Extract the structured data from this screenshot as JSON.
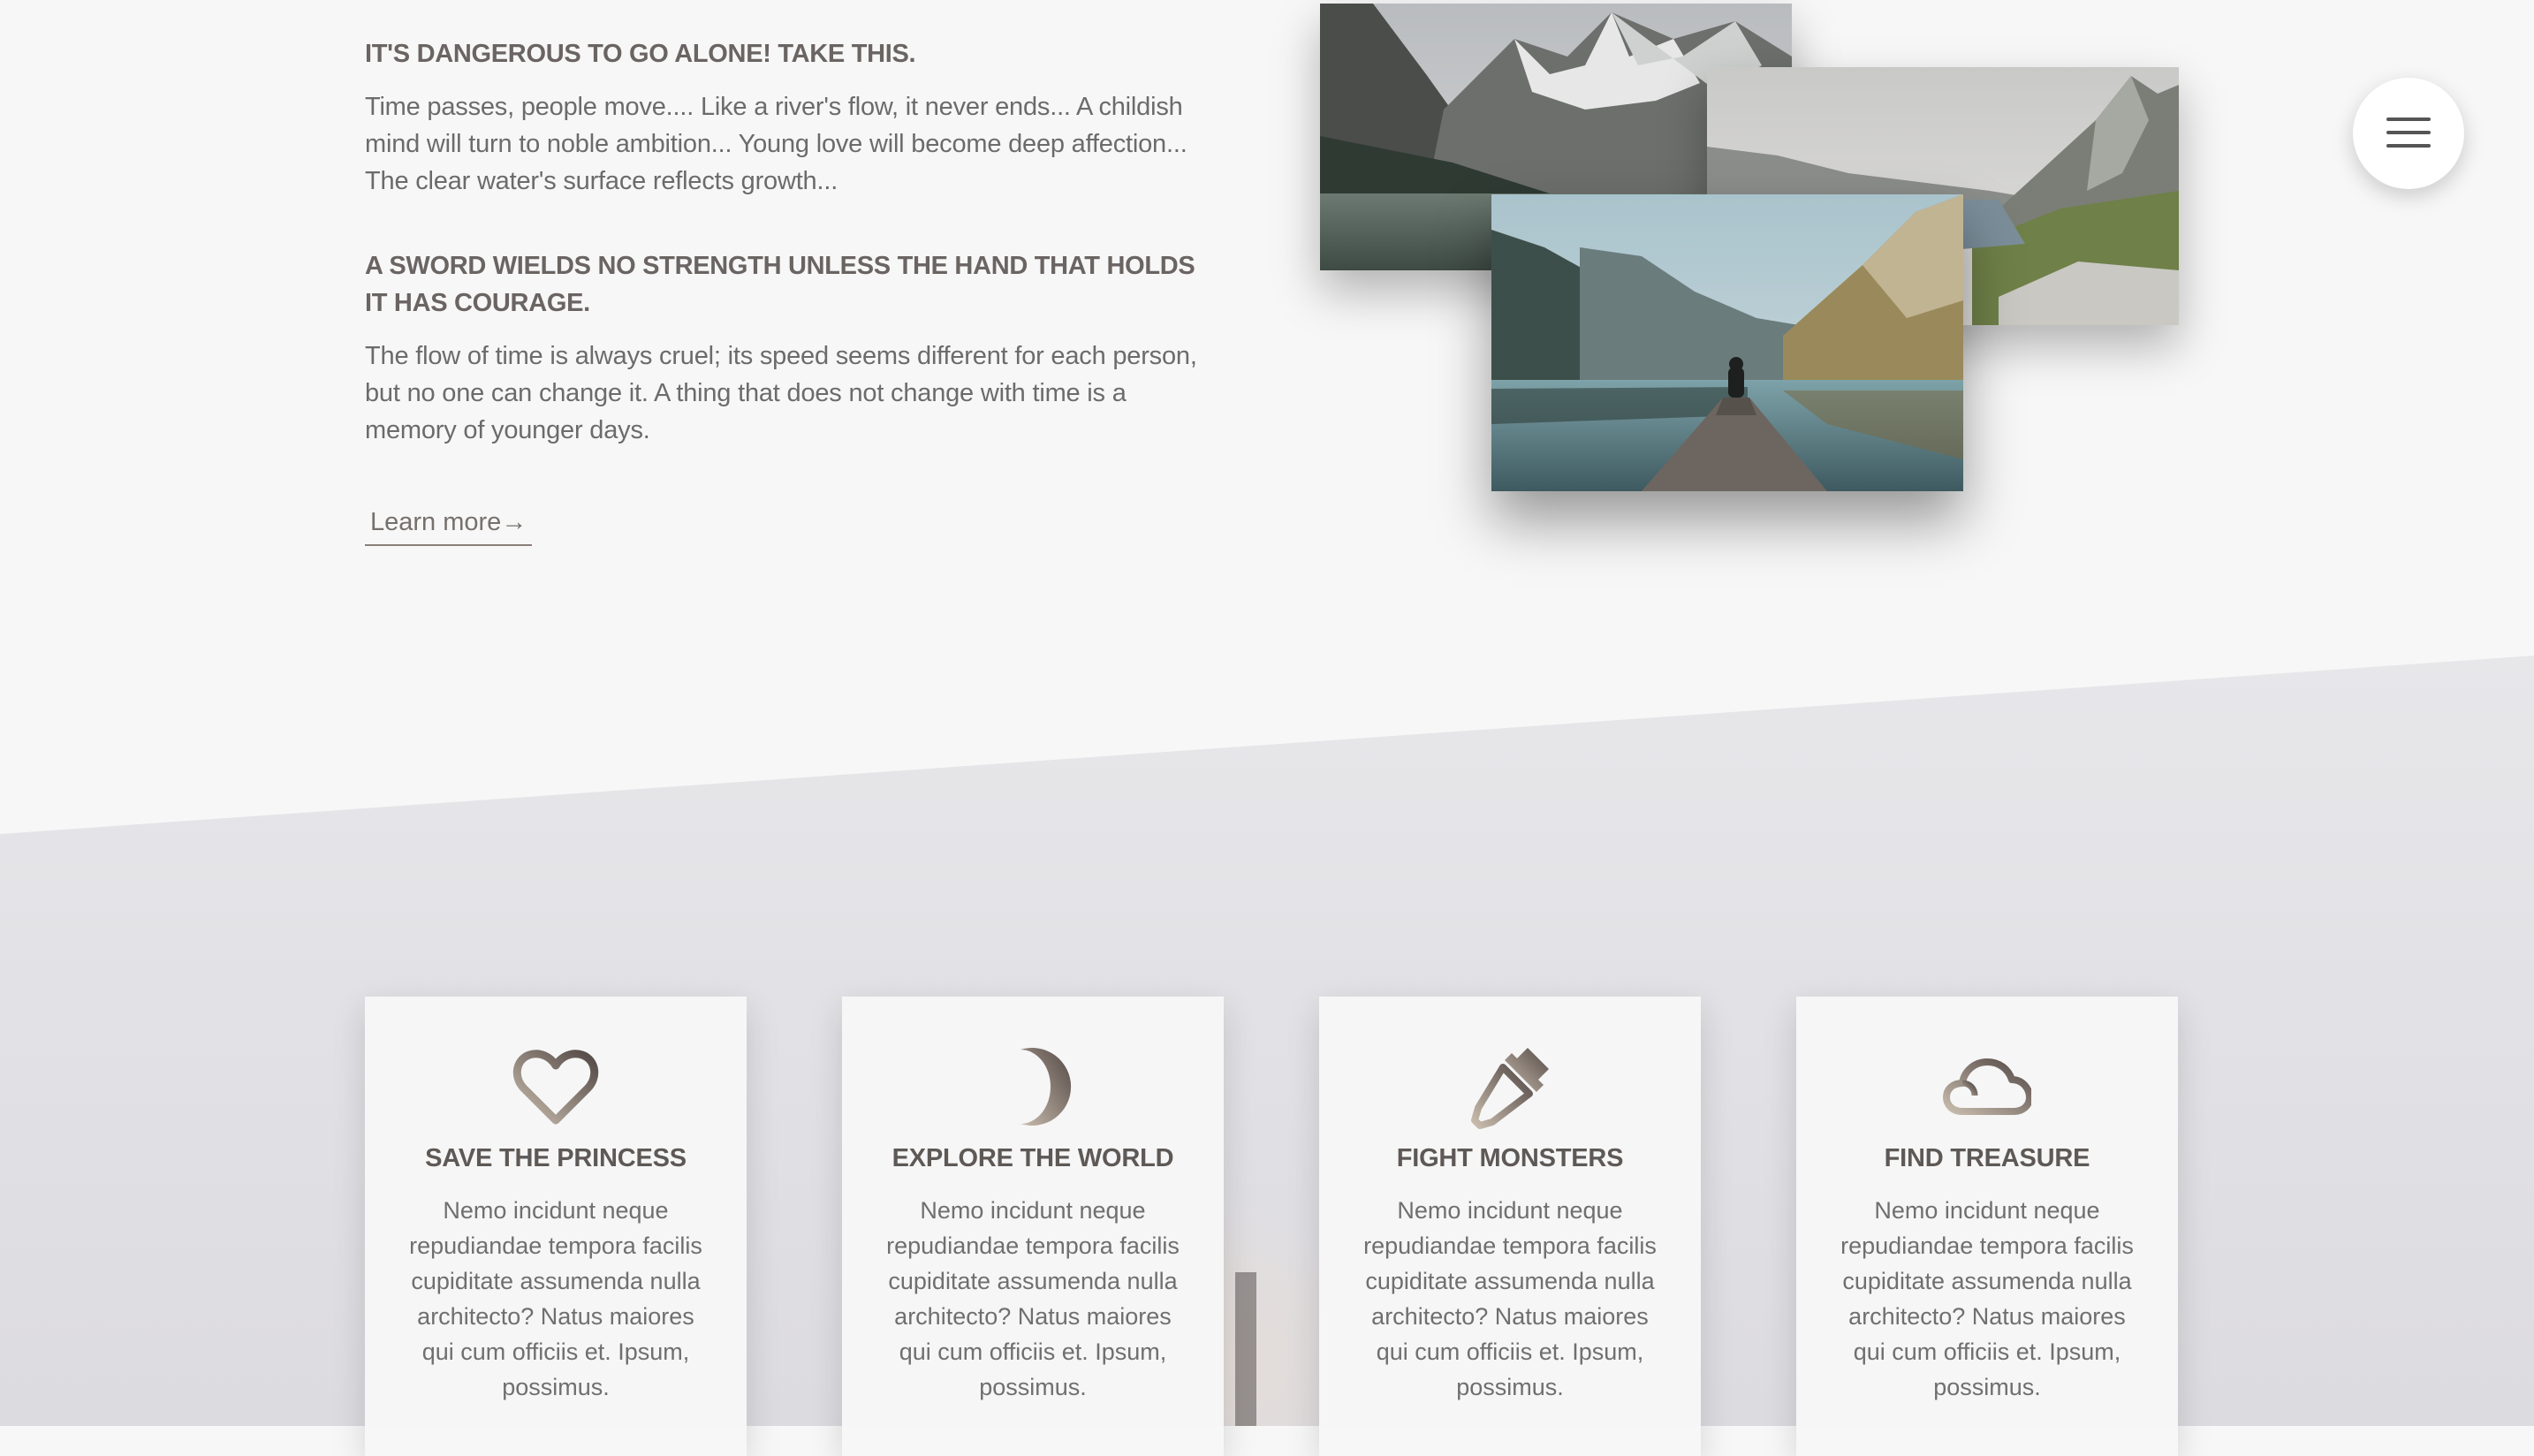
{
  "intro": {
    "heading_1": "IT'S DANGEROUS TO GO ALONE! TAKE THIS.",
    "paragraph_1": "Time passes, people move.... Like a river's flow, it never ends... A childish mind will turn to noble ambition... Young love will become deep affection... The clear water's surface reflects growth...",
    "heading_2": "A SWORD WIELDS NO STRENGTH UNLESS THE HAND THAT HOLDS IT HAS COURAGE.",
    "paragraph_2": "The flow of time is always cruel; its speed seems different for each person, but no one can change it. A thing that does not change with time is a memory of younger days.",
    "learn_more_label": "Learn more",
    "learn_more_arrow": "→"
  },
  "photos": [
    {
      "name": "mountain-lake-photo"
    },
    {
      "name": "alpine-valley-photo"
    },
    {
      "name": "dock-lake-photo"
    }
  ],
  "menu": {
    "icon": "hamburger-menu-icon"
  },
  "features": [
    {
      "icon": "heart-icon",
      "title": "SAVE THE PRINCESS",
      "text": "Nemo incidunt neque repudiandae tempora facilis cupiditate assumenda nulla architecto? Natus maiores qui cum officiis et. Ipsum, possimus."
    },
    {
      "icon": "moon-icon",
      "title": "EXPLORE THE WORLD",
      "text": "Nemo incidunt neque repudiandae tempora facilis cupiditate assumenda nulla architecto? Natus maiores qui cum officiis et. Ipsum, possimus."
    },
    {
      "icon": "dropper-icon",
      "title": "FIGHT MONSTERS",
      "text": "Nemo incidunt neque repudiandae tempora facilis cupiditate assumenda nulla architecto? Natus maiores qui cum officiis et. Ipsum, possimus."
    },
    {
      "icon": "cloud-icon",
      "title": "FIND TREASURE",
      "text": "Nemo incidunt neque repudiandae tempora facilis cupiditate assumenda nulla architecto? Natus maiores qui cum officiis et. Ipsum, possimus."
    }
  ],
  "colors": {
    "background": "#f7f7f7",
    "slanted_band": "#e6e6e9",
    "heading_text": "#6a6462",
    "body_text": "#6b6b6b",
    "icon_gradient_start": "#c4b7a6",
    "icon_gradient_end": "#5b4f4b"
  }
}
